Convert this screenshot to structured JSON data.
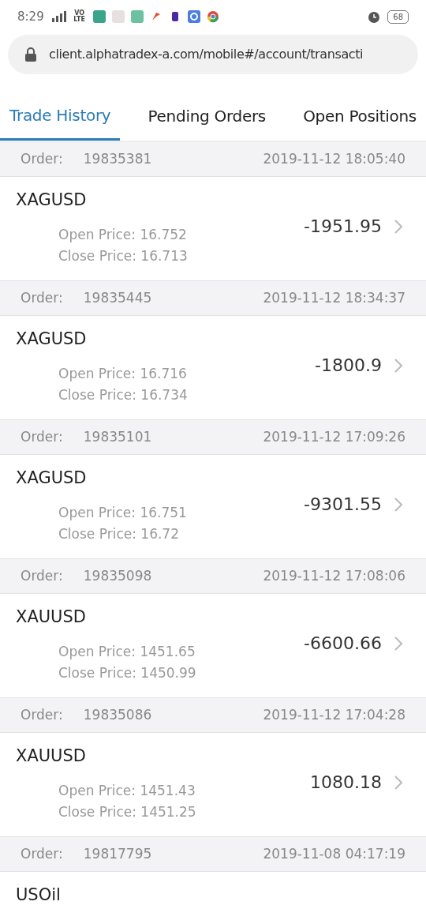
{
  "status_bar": {
    "time": "8:29",
    "network": "VO LTE",
    "battery": "68"
  },
  "address_bar": {
    "url": "client.alphatradex-a.com/mobile#/account/transacti"
  },
  "tabs": [
    {
      "label": "Trade History",
      "selected": true
    },
    {
      "label": "Pending Orders",
      "selected": false
    },
    {
      "label": "Open Positions",
      "selected": false
    }
  ],
  "orders": [
    {
      "order_label": "Order:",
      "order": "19835381",
      "time": "2019-11-12 18:05:40",
      "symbol": "XAGUSD",
      "open_label": "Open Price:",
      "open": "16.752",
      "close_label": "Close Price:",
      "close": "16.713",
      "amount": "-1951.95"
    },
    {
      "order_label": "Order:",
      "order": "19835445",
      "time": "2019-11-12 18:34:37",
      "symbol": "XAGUSD",
      "open_label": "Open Price:",
      "open": "16.716",
      "close_label": "Close Price:",
      "close": "16.734",
      "amount": "-1800.9"
    },
    {
      "order_label": "Order:",
      "order": "19835101",
      "time": "2019-11-12 17:09:26",
      "symbol": "XAGUSD",
      "open_label": "Open Price:",
      "open": "16.751",
      "close_label": "Close Price:",
      "close": "16.72",
      "amount": "-9301.55"
    },
    {
      "order_label": "Order:",
      "order": "19835098",
      "time": "2019-11-12 17:08:06",
      "symbol": "XAUUSD",
      "open_label": "Open Price:",
      "open": "1451.65",
      "close_label": "Close Price:",
      "close": "1450.99",
      "amount": "-6600.66"
    },
    {
      "order_label": "Order:",
      "order": "19835086",
      "time": "2019-11-12 17:04:28",
      "symbol": "XAUUSD",
      "open_label": "Open Price:",
      "open": "1451.43",
      "close_label": "Close Price:",
      "close": "1451.25",
      "amount": "1080.18"
    },
    {
      "order_label": "Order:",
      "order": "19817795",
      "time": "2019-11-08 04:17:19",
      "symbol": "USOil"
    }
  ]
}
